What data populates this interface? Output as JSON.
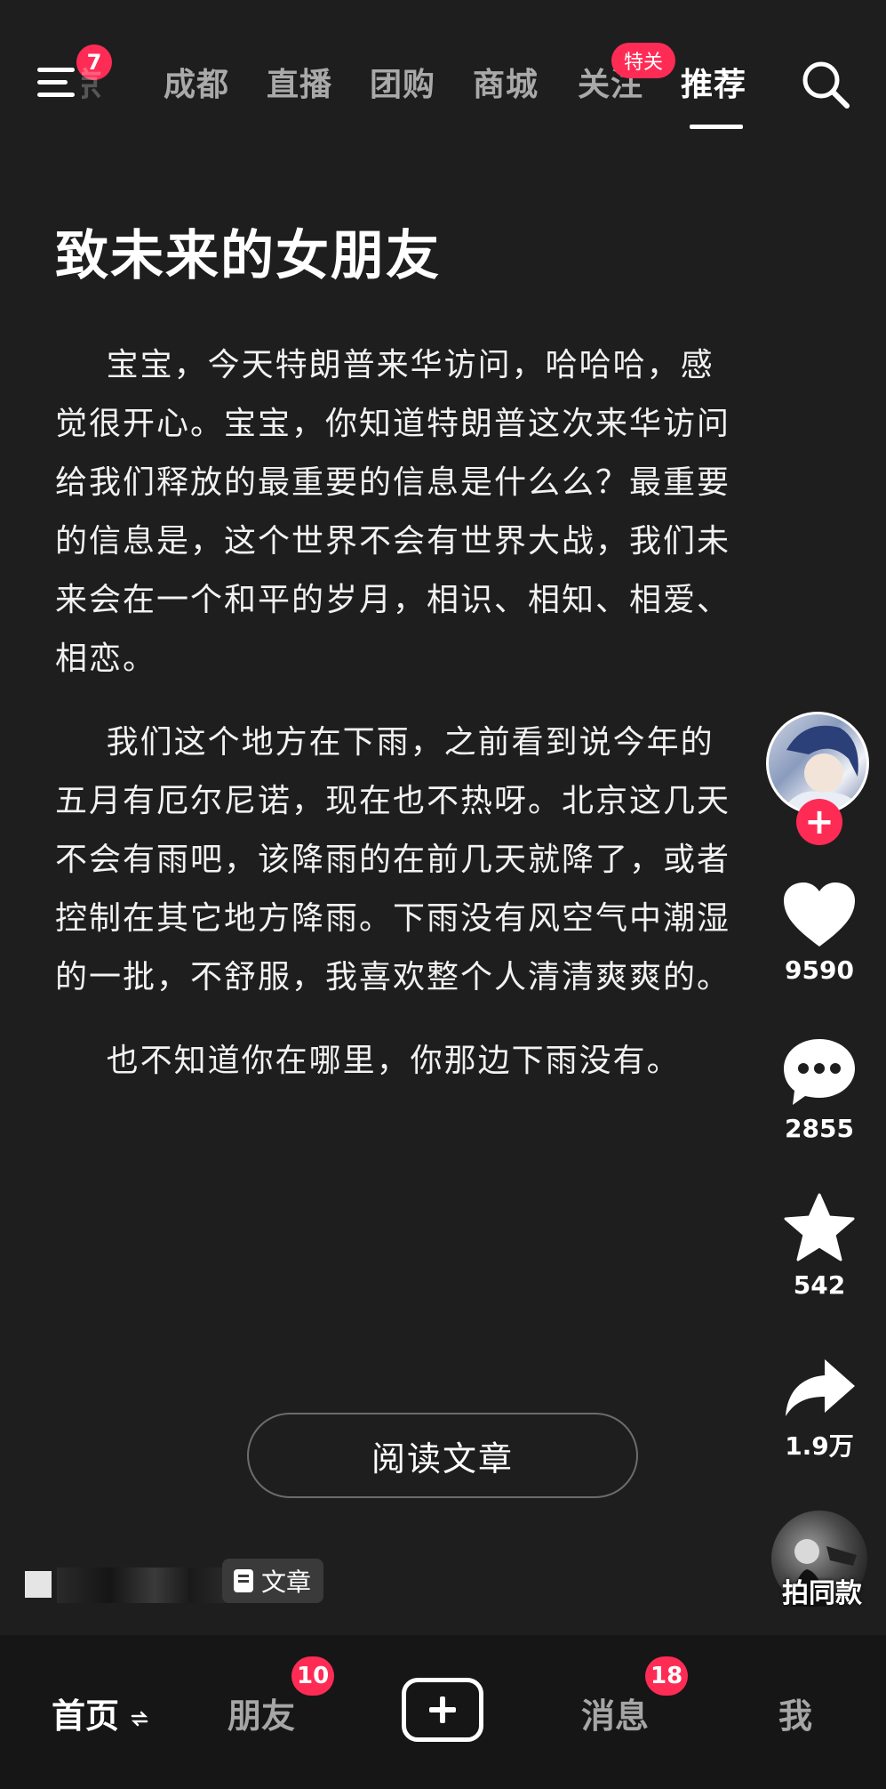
{
  "top_nav": {
    "menu_badge": "7",
    "tabs": [
      {
        "label": "京"
      },
      {
        "label": "成都"
      },
      {
        "label": "直播"
      },
      {
        "label": "团购"
      },
      {
        "label": "商城"
      },
      {
        "label": "关注"
      },
      {
        "label": "推荐"
      }
    ],
    "follow_badge": "特关",
    "active_tab": "推荐"
  },
  "article": {
    "title": "致未来的女朋友",
    "paragraphs": [
      "宝宝，今天特朗普来华访问，哈哈哈，感觉很开心。宝宝，你知道特朗普这次来华访问给我们释放的最重要的信息是什么么？最重要的信息是，这个世界不会有世界大战，我们未来会在一个和平的岁月，相识、相知、相爱、相恋。",
      "我们这个地方在下雨，之前看到说今年的五月有厄尔尼诺，现在也不热呀。北京这几天不会有雨吧，该降雨的在前几天就降了，或者控制在其它地方降雨。下雨没有风空气中潮湿的一批，不舒服，我喜欢整个人清清爽爽的。",
      "也不知道你在哪里，你那边下雨没有。"
    ],
    "read_button": "阅读文章"
  },
  "right_rail": {
    "likes": "9590",
    "comments": "2855",
    "favorites": "542",
    "shares": "1.9万",
    "music_label": "拍同款"
  },
  "author": {
    "tag_label": "文章"
  },
  "bottom_nav": {
    "home": "首页",
    "friends": "朋友",
    "friends_badge": "10",
    "messages": "消息",
    "messages_badge": "18",
    "me": "我"
  },
  "colors": {
    "background": "#1e1e1f",
    "accent": "#fe2c55",
    "nav_background": "#161617"
  }
}
